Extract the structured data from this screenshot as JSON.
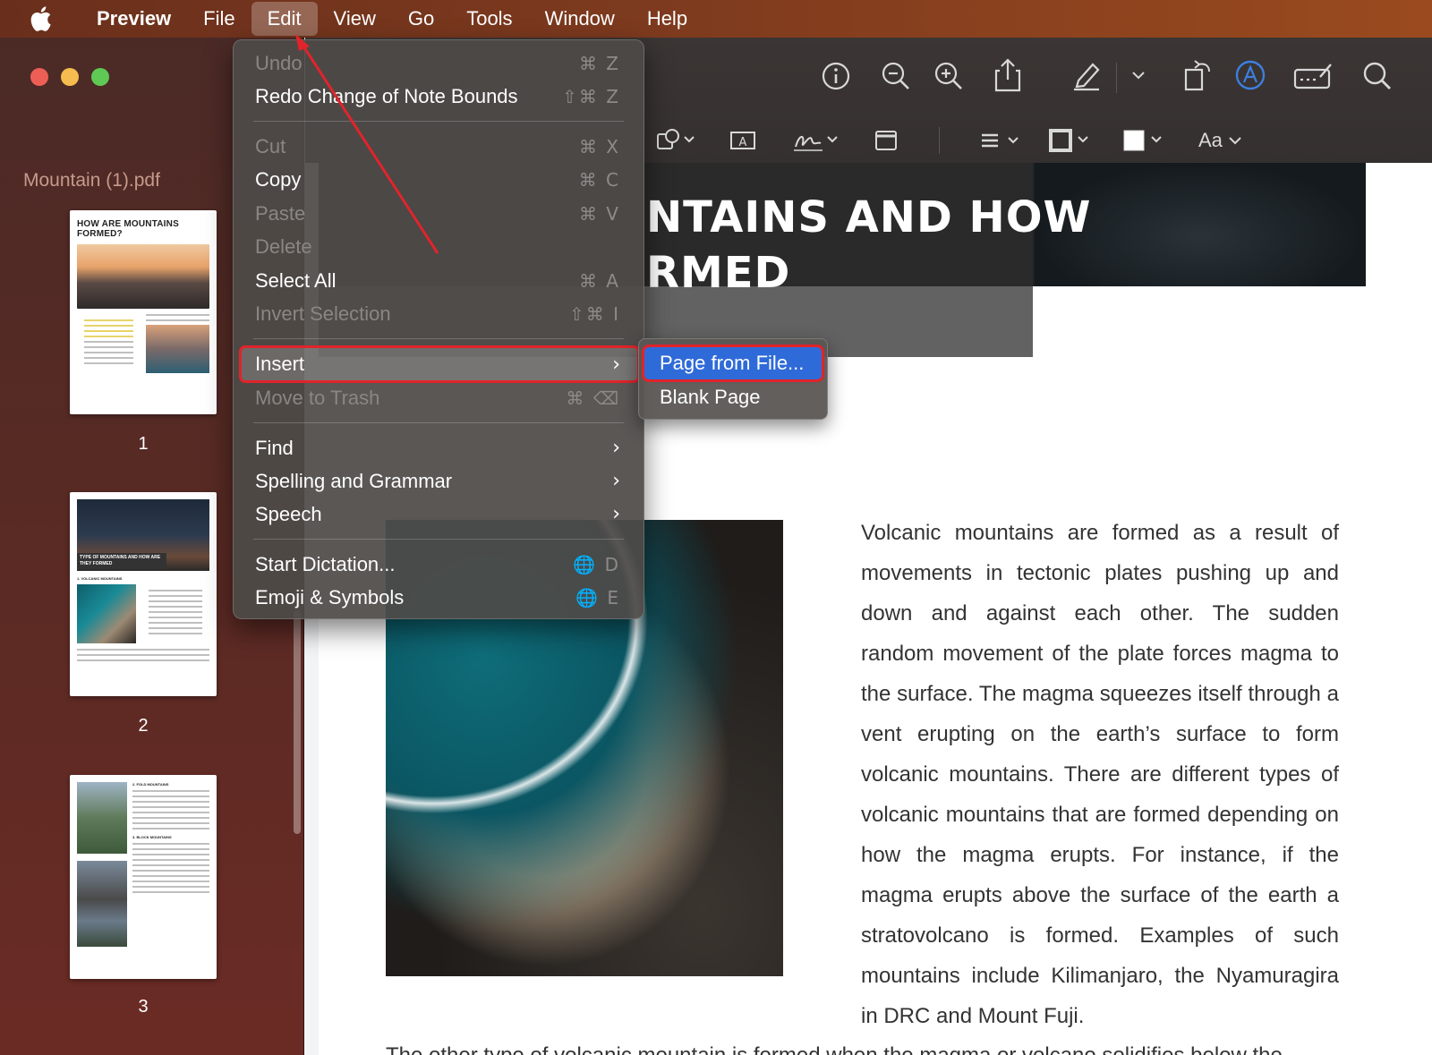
{
  "menubar": {
    "app_name": "Preview",
    "items": [
      "File",
      "Edit",
      "View",
      "Go",
      "Tools",
      "Window",
      "Help"
    ]
  },
  "sidebar": {
    "document_name": "Mountain (1).pdf",
    "thumbnails": [
      {
        "page": "1",
        "title": "HOW ARE MOUNTAINS FORMED?"
      },
      {
        "page": "2",
        "title": "TYPE OF MOUNTAINS AND HOW ARE THEY FORMED",
        "subtitle": "1. VOLCANIC MOUNTAINS"
      },
      {
        "page": "3",
        "heading_a": "2. FOLD MOUNTAINS",
        "heading_b": "3. BLOCK MOUNTAINS"
      }
    ]
  },
  "toolbar": {
    "icons": [
      "info-icon",
      "zoom-out-icon",
      "zoom-in-icon",
      "share-icon",
      "highlight-pen-icon",
      "chevron-down-icon",
      "rotate-icon",
      "markup-icon",
      "form-fill-icon",
      "search-icon"
    ],
    "markup_tools": [
      "shapes-icon",
      "text-box-icon",
      "signature-icon",
      "note-icon",
      "align-icon",
      "border-color-icon",
      "fill-color-icon"
    ],
    "font_label": "Aa"
  },
  "edit_menu": {
    "items": [
      {
        "label": "Undo",
        "shortcut": "⌘ Z",
        "disabled": true
      },
      {
        "label": "Redo Change of Note Bounds",
        "shortcut": "⇧⌘ Z",
        "disabled": false
      },
      {
        "label": "Cut",
        "shortcut": "⌘ X",
        "disabled": true
      },
      {
        "label": "Copy",
        "shortcut": "⌘ C",
        "disabled": false
      },
      {
        "label": "Paste",
        "shortcut": "⌘ V",
        "disabled": true
      },
      {
        "label": "Delete",
        "shortcut": "",
        "disabled": true
      },
      {
        "label": "Select All",
        "shortcut": "⌘ A",
        "disabled": false
      },
      {
        "label": "Invert Selection",
        "shortcut": "⇧⌘ I",
        "disabled": true
      },
      {
        "label": "Insert",
        "shortcut": "",
        "disabled": false
      },
      {
        "label": "Move to Trash",
        "shortcut": "⌘ ⌫",
        "disabled": true
      },
      {
        "label": "Find",
        "shortcut": "",
        "disabled": false
      },
      {
        "label": "Spelling and Grammar",
        "shortcut": "",
        "disabled": false
      },
      {
        "label": "Speech",
        "shortcut": "",
        "disabled": false
      },
      {
        "label": "Start Dictation...",
        "shortcut": "🌐 D",
        "disabled": false
      },
      {
        "label": "Emoji & Symbols",
        "shortcut": "🌐 E",
        "disabled": false
      }
    ]
  },
  "insert_submenu": {
    "items": [
      "Page from File...",
      "Blank Page"
    ]
  },
  "document": {
    "hero_title_line1": "NTAINS AND HOW",
    "hero_title_line2": "RMED",
    "paragraph": "Volcanic mountains are formed as a result of movements in tectonic plates pushing up and down and against each other. The sudden random movement of the plate forces magma to the surface. The magma squeezes itself through a vent erupting on the earth’s surface to form volcanic mountains. There are different types of volcanic mountains that are formed depending on how the magma erupts. For instance, if the magma erupts above the surface of the earth a stratovolcano is formed. Examples of such mountains include Kilimanjaro, the Nyamuragira in DRC and Mount Fuji.",
    "paragraph2": "The other type of volcanic mountain is formed when the magma or volcano solidifies below the"
  },
  "colors": {
    "highlight_outline": "#e0242b",
    "selection_blue": "#2f6bd8",
    "annotation_arrow": "#e0242b"
  }
}
